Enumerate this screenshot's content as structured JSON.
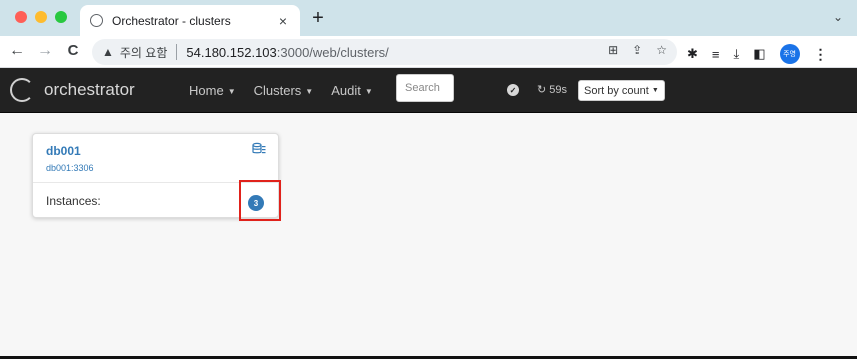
{
  "browser": {
    "tab_title": "Orchestrator - clusters",
    "tab_close": "×",
    "new_tab": "+",
    "tab_list": "⌄",
    "back": "←",
    "forward": "→",
    "reload": "C",
    "security_warning": "주의 요함",
    "url_host": "54.180.152.103",
    "url_path": ":3000/web/clusters/",
    "profile_label": "주영",
    "menu": "⋮"
  },
  "navbar": {
    "brand": "orchestrator",
    "menu": [
      {
        "label": "Home"
      },
      {
        "label": "Clusters"
      },
      {
        "label": "Audit"
      }
    ],
    "search_placeholder": "Search",
    "refresh_countdown": "59s",
    "sort_label": "Sort by count"
  },
  "clusters": [
    {
      "name": "db001",
      "alias": "db001:3306",
      "instances_label": "Instances:",
      "instances_count": "3"
    }
  ],
  "colors": {
    "navbar_bg": "#222222",
    "link": "#337ab7",
    "badge": "#337ab7",
    "highlight": "#e0221b"
  }
}
